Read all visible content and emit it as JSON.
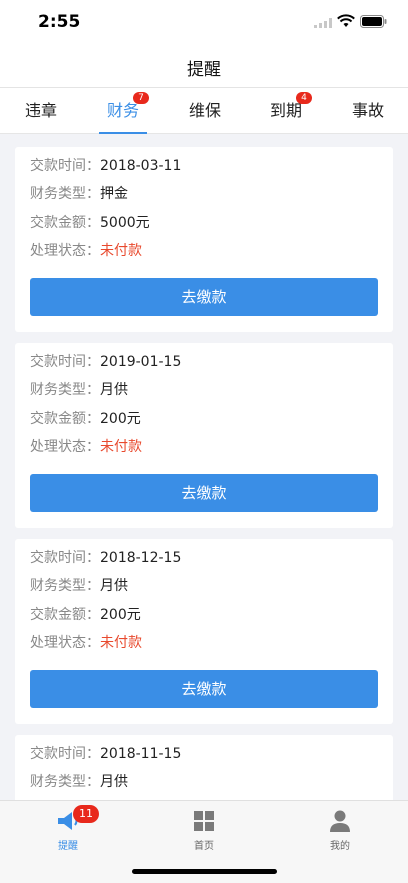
{
  "status_bar": {
    "time": "2:55"
  },
  "header": {
    "title": "提醒"
  },
  "tabs": [
    {
      "label": "违章",
      "badge": ""
    },
    {
      "label": "财务",
      "badge": "7"
    },
    {
      "label": "维保",
      "badge": ""
    },
    {
      "label": "到期",
      "badge": "4"
    },
    {
      "label": "事故",
      "badge": ""
    }
  ],
  "active_tab": "财务",
  "labels": {
    "time": "交款时间：",
    "type": "财务类型：",
    "amount": "交款金额：",
    "status": "处理状态："
  },
  "records": [
    {
      "time": "2018-03-11",
      "type": "押金",
      "amount": "5000元",
      "status": "未付款",
      "button": "去缴款"
    },
    {
      "time": "2019-01-15",
      "type": "月供",
      "amount": "200元",
      "status": "未付款",
      "button": "去缴款"
    },
    {
      "time": "2018-12-15",
      "type": "月供",
      "amount": "200元",
      "status": "未付款",
      "button": "去缴款"
    },
    {
      "time": "2018-11-15",
      "type": "月供"
    }
  ],
  "tabbar": {
    "items": [
      {
        "label": "提醒",
        "icon": "megaphone-icon",
        "badge": "11"
      },
      {
        "label": "首页",
        "icon": "grid-icon"
      },
      {
        "label": "我的",
        "icon": "person-icon"
      }
    ]
  },
  "colors": {
    "accent": "#3a8ee6",
    "unpaid": "#e8492d",
    "badge": "#e8291c"
  }
}
